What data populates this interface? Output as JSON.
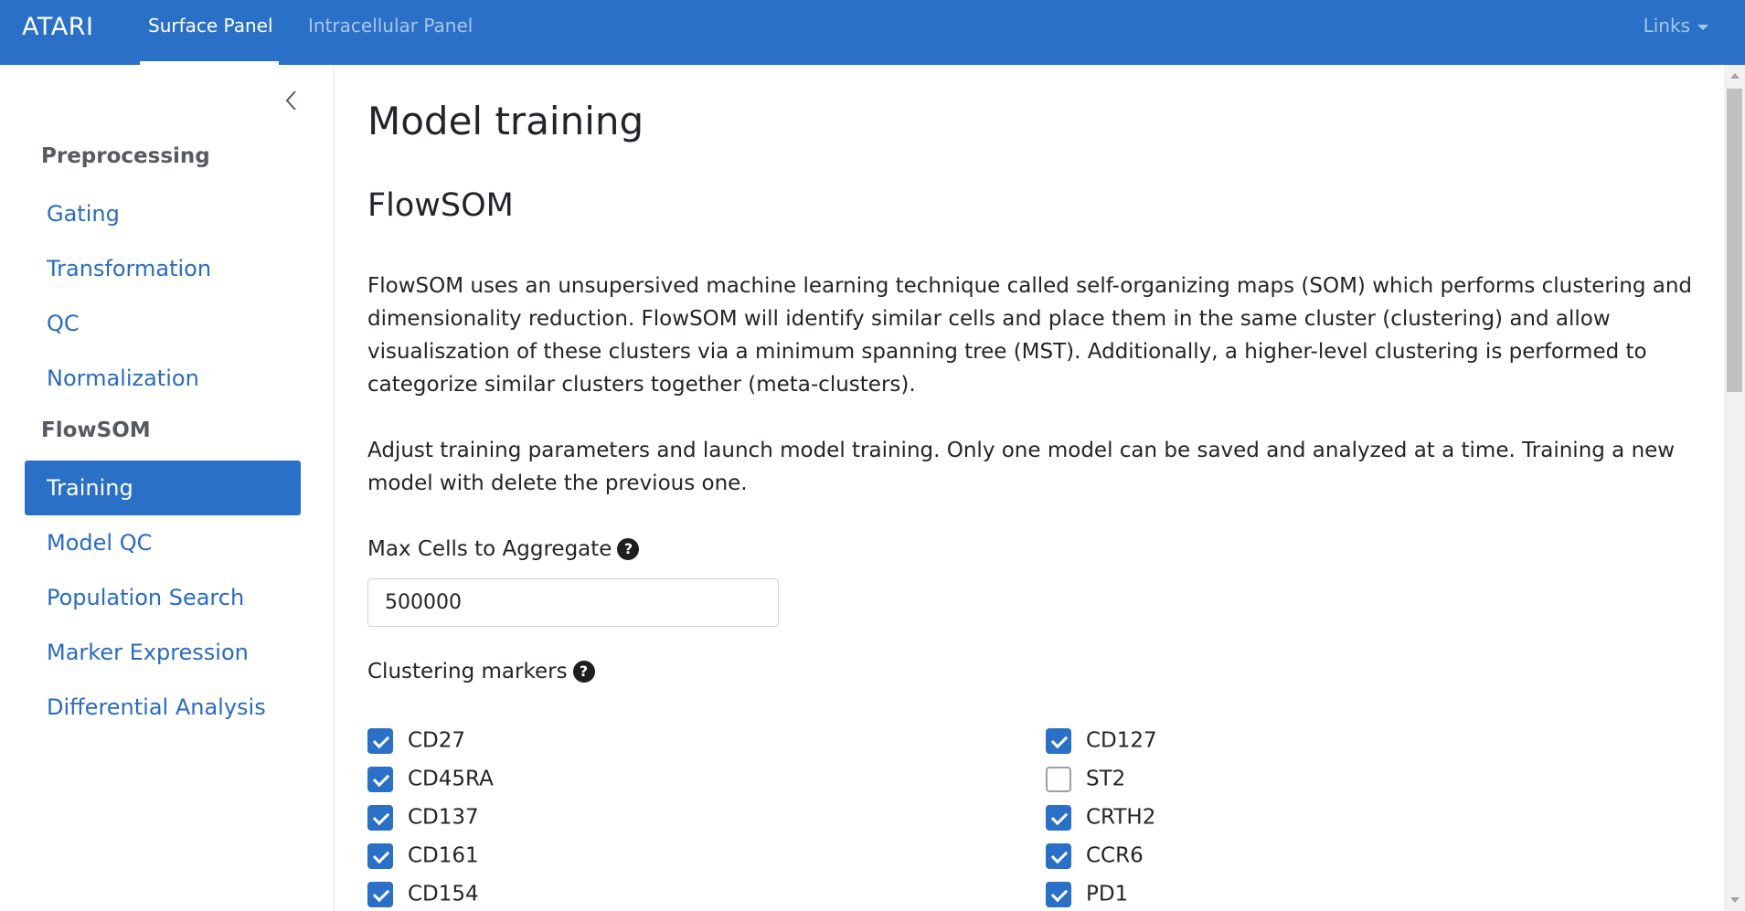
{
  "navbar": {
    "brand": "ATARI",
    "tabs": [
      {
        "label": "Surface Panel",
        "active": true
      },
      {
        "label": "Intracellular Panel",
        "active": false
      }
    ],
    "links_label": "Links",
    "color": "#2970c6"
  },
  "sidebar": {
    "collapse_icon": "chevron-left-icon",
    "sections": [
      {
        "title": "Preprocessing",
        "items": [
          "Gating",
          "Transformation",
          "QC",
          "Normalization"
        ]
      },
      {
        "title": "FlowSOM",
        "items": [
          "Training",
          "Model QC",
          "Population Search",
          "Marker Expression",
          "Differential Analysis"
        ]
      }
    ],
    "active_item": "Training"
  },
  "main": {
    "title": "Model training",
    "subtitle": "FlowSOM",
    "description": "FlowSOM uses an unsupersived machine learning technique called self-organizing maps (SOM) which performs clustering and dimensionality reduction. FlowSOM will identify similar cells and place them in the same cluster (clustering) and allow visualiszation of these clusters via a minimum spanning tree (MST). Additionally, a higher-level clustering is performed to categorize similar clusters together (meta-clusters).",
    "instructions": "Adjust training parameters and launch model training. Only one model can be saved and analyzed at a time. Training a new model with delete the previous one.",
    "max_cells": {
      "label": "Max Cells to Aggregate",
      "value": "500000"
    },
    "clustering_markers": {
      "label": "Clustering markers",
      "left_column": [
        {
          "name": "CD27",
          "checked": true
        },
        {
          "name": "CD45RA",
          "checked": true
        },
        {
          "name": "CD137",
          "checked": true
        },
        {
          "name": "CD161",
          "checked": true
        },
        {
          "name": "CD154",
          "checked": true
        }
      ],
      "right_column": [
        {
          "name": "CD127",
          "checked": true
        },
        {
          "name": "ST2",
          "checked": false
        },
        {
          "name": "CRTH2",
          "checked": true
        },
        {
          "name": "CCR6",
          "checked": true
        },
        {
          "name": "PD1",
          "checked": true
        }
      ]
    },
    "help_icon": "question-circle-icon"
  }
}
